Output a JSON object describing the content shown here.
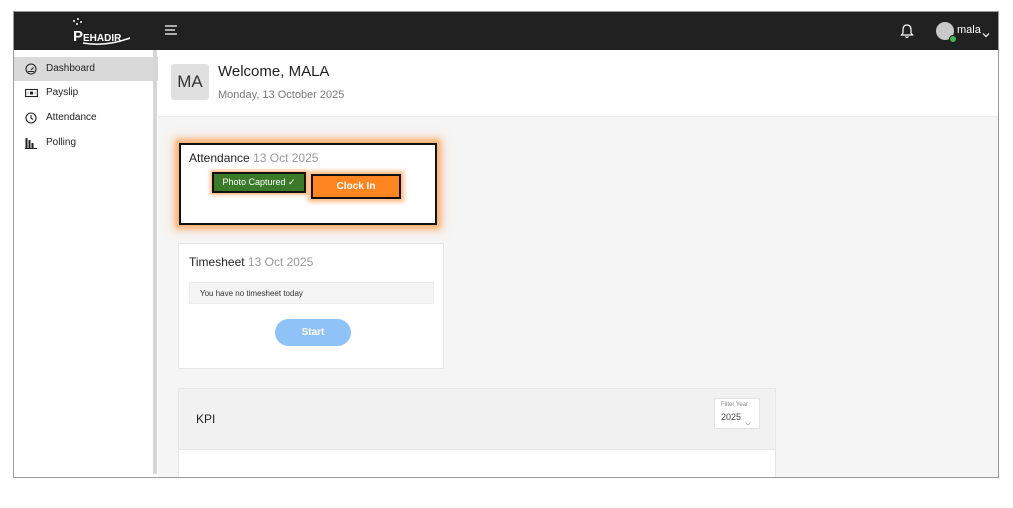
{
  "header": {
    "logo_text": "EHADIR",
    "user_name": "mala",
    "icons": [
      "hamburger-menu-icon",
      "bell-icon",
      "user-avatar",
      "chevron-down-icon"
    ]
  },
  "sidebar": {
    "items": [
      {
        "label": "Dashboard",
        "icon": "speedometer-icon",
        "active": true
      },
      {
        "label": "Payslip",
        "icon": "payslip-icon",
        "active": false
      },
      {
        "label": "Attendance",
        "icon": "clock-icon",
        "active": false
      },
      {
        "label": "Polling",
        "icon": "bar-chart-icon",
        "active": false
      }
    ]
  },
  "welcome": {
    "initials": "MA",
    "title": "Welcome, MALA",
    "date": "Monday, 13 October 2025"
  },
  "attendance": {
    "title": "Attendance",
    "date": "13 Oct 2025",
    "photo_status": "Photo Captured ✓",
    "clock_in_label": "Clock In"
  },
  "timesheet": {
    "title": "Timesheet",
    "date": "13 Oct 2025",
    "empty_message": "You have no timesheet today",
    "start_label": "Start"
  },
  "kpi": {
    "title": "KPI",
    "filter_label": "Filter Year",
    "filter_value": "2025"
  },
  "colors": {
    "topbar": "#212121",
    "clock_in": "#ff8520",
    "photo_captured": "#3a7a29",
    "start_button": "#8fc3f7"
  }
}
